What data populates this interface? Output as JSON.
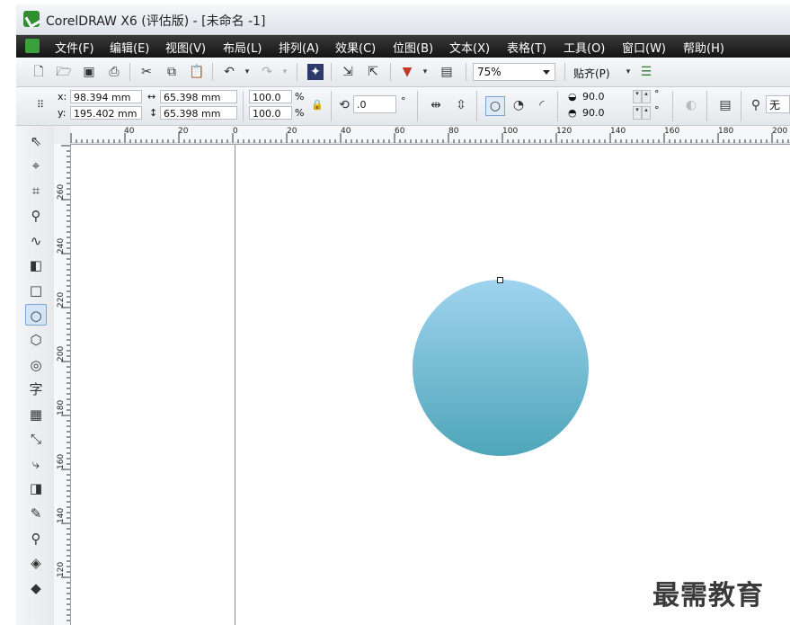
{
  "window": {
    "title": "CorelDRAW X6 (评估版) - [未命名 -1]"
  },
  "menu": {
    "items": [
      "文件(F)",
      "编辑(E)",
      "视图(V)",
      "布局(L)",
      "排列(A)",
      "效果(C)",
      "位图(B)",
      "文本(X)",
      "表格(T)",
      "工具(O)",
      "窗口(W)",
      "帮助(H)"
    ]
  },
  "standard_toolbar": {
    "zoom_value": "75%",
    "snap_label": "贴齐(P)"
  },
  "property_bar": {
    "x_label": "x:",
    "x_value": "98.394 mm",
    "y_label": "y:",
    "y_value": "195.402 mm",
    "width_value": "65.398 mm",
    "height_value": "65.398 mm",
    "scale_x": "100.0",
    "scale_y": "100.0",
    "percent_symbol": "%",
    "rotation_value": ".0",
    "degree_symbol": "°",
    "start_angle": "90.0",
    "end_angle": "90.0",
    "outline_value": "无"
  },
  "ruler": {
    "top_labels": [
      "40",
      "20",
      "0",
      "20",
      "40",
      "60",
      "80",
      "100",
      "120",
      "140",
      "160",
      "180",
      "200"
    ],
    "left_labels": [
      "260",
      "240",
      "220",
      "200",
      "180",
      "160",
      "140",
      "120"
    ]
  },
  "watermark": "最需教育",
  "colors": {
    "circle_top": "#9fd3ee",
    "circle_bottom": "#4ea6b9",
    "menubar": "#1c1c1c"
  }
}
